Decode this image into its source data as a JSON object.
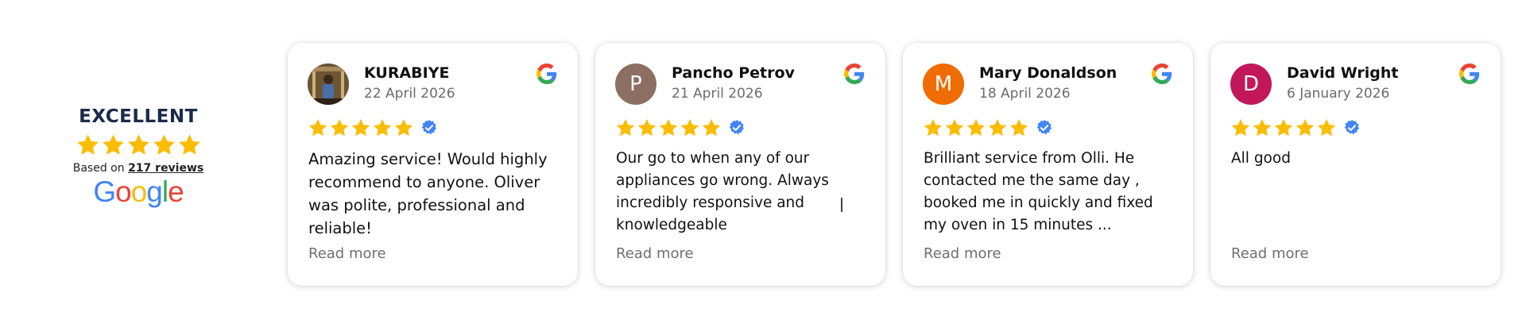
{
  "summary": {
    "rating_word": "EXCELLENT",
    "stars": 5,
    "based_on_prefix": "Based on",
    "reviews_link": "217 reviews",
    "logo_text": "Google"
  },
  "colors": {
    "star": "#fbbc04",
    "verified": "#4285f4",
    "google_blue": "#4285f4",
    "google_red": "#ea4335",
    "google_yellow": "#fbbc05",
    "google_green": "#34a853"
  },
  "reviews": [
    {
      "name": "KURABIYE",
      "date": "22 April 2026",
      "avatar": {
        "type": "photo",
        "letter": "",
        "color": ""
      },
      "stars": 5,
      "text": "Amazing service! Would highly recommend to anyone. Oliver was polite, professional and reliable!",
      "read_more": "Read more"
    },
    {
      "name": "Pancho Petrov",
      "date": "21 April 2026",
      "avatar": {
        "type": "letter",
        "letter": "P",
        "color": "#8d6e63"
      },
      "stars": 5,
      "text": "Our go to when any of our appliances go wrong. Always incredibly responsive and knowledgeable",
      "read_more": "Read more"
    },
    {
      "name": "Mary Donaldson",
      "date": "18 April 2026",
      "avatar": {
        "type": "letter",
        "letter": "M",
        "color": "#ef6c00"
      },
      "stars": 5,
      "text": "Brilliant service from Olli. He contacted me the same day , booked me in quickly and fixed my oven in 15 minutes ...",
      "read_more": "Read more"
    },
    {
      "name": "David Wright",
      "date": "6 January 2026",
      "avatar": {
        "type": "letter",
        "letter": "D",
        "color": "#c2185b"
      },
      "stars": 5,
      "text": "All good",
      "read_more": "Read more"
    }
  ]
}
